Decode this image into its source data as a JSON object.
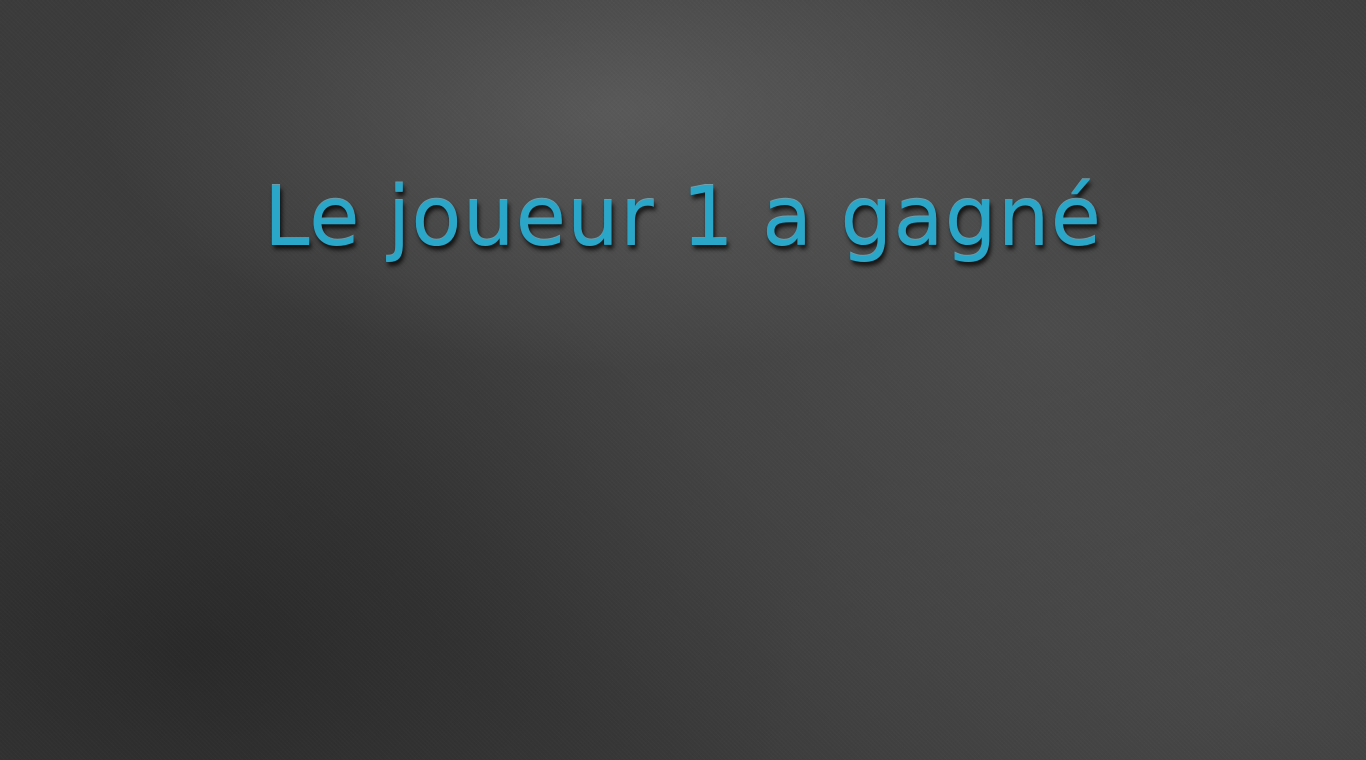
{
  "game": {
    "result_message": "Le joueur 1 a gagné"
  },
  "colors": {
    "background": "#3b3b3b",
    "title_text": "#2aa6c9"
  }
}
